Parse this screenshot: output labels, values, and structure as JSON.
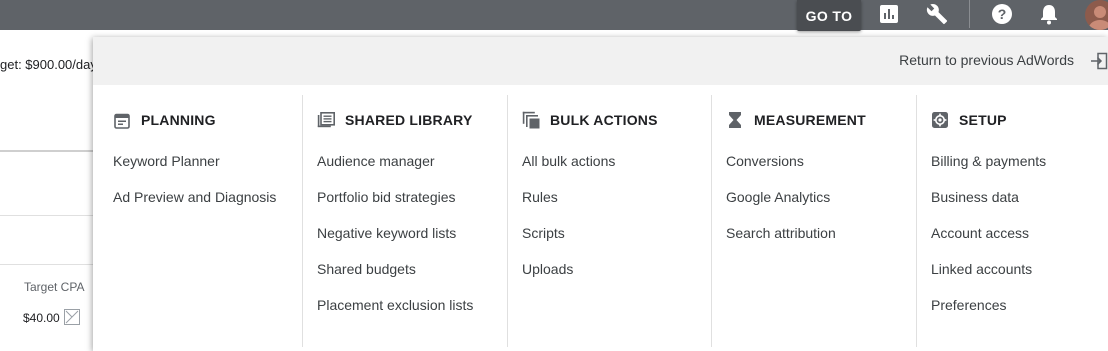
{
  "topbar": {
    "goto_label": "GO TO",
    "icons": [
      "reports-icon",
      "tools-icon",
      "help-icon",
      "notifications-icon",
      "avatar"
    ]
  },
  "background": {
    "budget_text": "get: $900.00/day",
    "target_cpa_header": "Target CPA",
    "target_cpa_value": "$40.00"
  },
  "panel": {
    "return_label": "Return to previous AdWords",
    "columns": [
      {
        "title": "PLANNING",
        "icon": "calendar-icon",
        "items": [
          "Keyword Planner",
          "Ad Preview and Diagnosis"
        ]
      },
      {
        "title": "SHARED LIBRARY",
        "icon": "library-icon",
        "items": [
          "Audience manager",
          "Portfolio bid strategies",
          "Negative keyword lists",
          "Shared budgets",
          "Placement exclusion lists"
        ]
      },
      {
        "title": "BULK ACTIONS",
        "icon": "copy-icon",
        "items": [
          "All bulk actions",
          "Rules",
          "Scripts",
          "Uploads"
        ]
      },
      {
        "title": "MEASUREMENT",
        "icon": "hourglass-icon",
        "items": [
          "Conversions",
          "Google Analytics",
          "Search attribution"
        ]
      },
      {
        "title": "SETUP",
        "icon": "settings-icon",
        "items": [
          "Billing & payments",
          "Business data",
          "Account access",
          "Linked accounts",
          "Preferences"
        ]
      }
    ]
  }
}
